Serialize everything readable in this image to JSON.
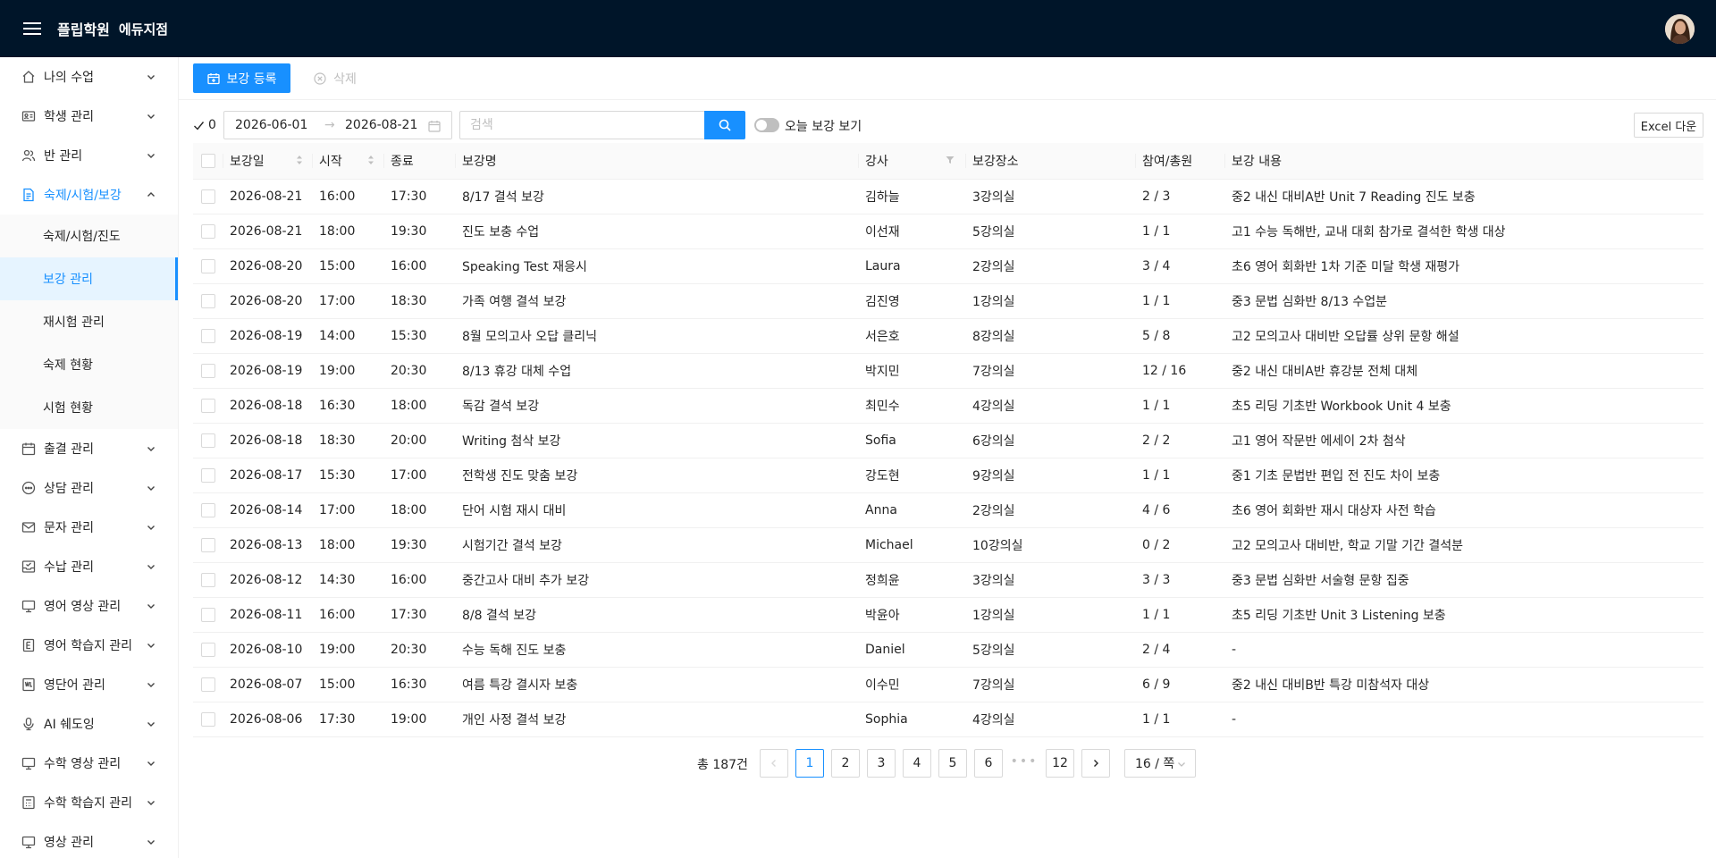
{
  "header": {
    "brand": "플립학원",
    "branch": "에듀지점"
  },
  "sidebar": {
    "items": [
      {
        "label": "나의 수업",
        "icon": "home-icon"
      },
      {
        "label": "학생 관리",
        "icon": "id-card-icon"
      },
      {
        "label": "반 관리",
        "icon": "users-icon"
      },
      {
        "label": "숙제/시험/보강",
        "icon": "file-icon",
        "open": true,
        "children": [
          {
            "label": "숙제/시험/진도"
          },
          {
            "label": "보강 관리",
            "active": true
          },
          {
            "label": "재시험 관리"
          },
          {
            "label": "숙제 현황"
          },
          {
            "label": "시험 현황"
          }
        ]
      },
      {
        "label": "출결 관리",
        "icon": "calendar-icon"
      },
      {
        "label": "상담 관리",
        "icon": "chat-icon"
      },
      {
        "label": "문자 관리",
        "icon": "mail-icon"
      },
      {
        "label": "수납 관리",
        "icon": "inbox-icon"
      },
      {
        "label": "영어 영상 관리",
        "icon": "monitor-icon"
      },
      {
        "label": "영어 학습지 관리",
        "icon": "book-icon"
      },
      {
        "label": "영단어 관리",
        "icon": "wordbook-icon"
      },
      {
        "label": "AI 쉐도잉",
        "icon": "microphone-icon"
      },
      {
        "label": "수학 영상 관리",
        "icon": "monitor-icon"
      },
      {
        "label": "수학 학습지 관리",
        "icon": "calculator-icon"
      },
      {
        "label": "영상 관리",
        "icon": "monitor-icon"
      }
    ]
  },
  "toolbar": {
    "register_label": "보강 등록",
    "delete_label": "삭제"
  },
  "filters": {
    "selected_count": "0",
    "date_from": "2026-06-01",
    "date_to": "2026-08-21",
    "date_separator": "→",
    "search_placeholder": "검색",
    "search_value": "",
    "today_toggle_label": "오늘 보강 보기",
    "excel_label": "Excel 다운"
  },
  "table": {
    "columns": [
      "보강일",
      "시작",
      "종료",
      "보강명",
      "강사",
      "보강장소",
      "참여/총원",
      "보강 내용"
    ],
    "rows": [
      [
        "2026-08-21",
        "16:00",
        "17:30",
        "8/17 결석 보강",
        "김하늘",
        "3강의실",
        "2 / 3",
        "중2 내신 대비A반 Unit 7 Reading 진도 보충"
      ],
      [
        "2026-08-21",
        "18:00",
        "19:30",
        "진도 보충 수업",
        "이선재",
        "5강의실",
        "1 / 1",
        "고1 수능 독해반, 교내 대회 참가로 결석한 학생 대상"
      ],
      [
        "2026-08-20",
        "15:00",
        "16:00",
        "Speaking Test 재응시",
        "Laura",
        "2강의실",
        "3 / 4",
        "초6 영어 회화반 1차 기준 미달 학생 재평가"
      ],
      [
        "2026-08-20",
        "17:00",
        "18:30",
        "가족 여행 결석 보강",
        "김진영",
        "1강의실",
        "1 / 1",
        "중3 문법 심화반 8/13 수업분"
      ],
      [
        "2026-08-19",
        "14:00",
        "15:30",
        "8월 모의고사 오답 클리닉",
        "서은호",
        "8강의실",
        "5 / 8",
        "고2 모의고사 대비반 오답률 상위 문항 해설"
      ],
      [
        "2026-08-19",
        "19:00",
        "20:30",
        "8/13 휴강 대체 수업",
        "박지민",
        "7강의실",
        "12 / 16",
        "중2 내신 대비A반 휴강분 전체 대체"
      ],
      [
        "2026-08-18",
        "16:30",
        "18:00",
        "독감 결석 보강",
        "최민수",
        "4강의실",
        "1 / 1",
        "초5 리딩 기초반 Workbook Unit 4 보충"
      ],
      [
        "2026-08-18",
        "18:30",
        "20:00",
        "Writing 첨삭 보강",
        "Sofia",
        "6강의실",
        "2 / 2",
        "고1 영어 작문반 에세이 2차 첨삭"
      ],
      [
        "2026-08-17",
        "15:30",
        "17:00",
        "전학생 진도 맞춤 보강",
        "강도현",
        "9강의실",
        "1 / 1",
        "중1 기초 문법반 편입 전 진도 차이 보충"
      ],
      [
        "2026-08-14",
        "17:00",
        "18:00",
        "단어 시험 재시 대비",
        "Anna",
        "2강의실",
        "4 / 6",
        "초6 영어 회화반 재시 대상자 사전 학습"
      ],
      [
        "2026-08-13",
        "18:00",
        "19:30",
        "시험기간 결석 보강",
        "Michael",
        "10강의실",
        "0 / 2",
        "고2 모의고사 대비반, 학교 기말 기간 결석분"
      ],
      [
        "2026-08-12",
        "14:30",
        "16:00",
        "중간고사 대비 추가 보강",
        "정희윤",
        "3강의실",
        "3 / 3",
        "중3 문법 심화반 서술형 문항 집중"
      ],
      [
        "2026-08-11",
        "16:00",
        "17:30",
        "8/8 결석 보강",
        "박윤아",
        "1강의실",
        "1 / 1",
        "초5 리딩 기초반 Unit 3 Listening 보충"
      ],
      [
        "2026-08-10",
        "19:00",
        "20:30",
        "수능 독해 진도 보충",
        "Daniel",
        "5강의실",
        "2 / 4",
        "-"
      ],
      [
        "2026-08-07",
        "15:00",
        "16:30",
        "여름 특강 결시자 보충",
        "이수민",
        "7강의실",
        "6 / 9",
        "중2 내신 대비B반 특강 미참석자 대상"
      ],
      [
        "2026-08-06",
        "17:30",
        "19:00",
        "개인 사정 결석 보강",
        "Sophia",
        "4강의실",
        "1 / 1",
        "-"
      ]
    ]
  },
  "pagination": {
    "total": "총 187건",
    "pages": [
      "1",
      "2",
      "3",
      "4",
      "5",
      "6"
    ],
    "ellipsis": "•••",
    "last_page": "12",
    "current": "1",
    "page_size": "16 / 쪽"
  }
}
